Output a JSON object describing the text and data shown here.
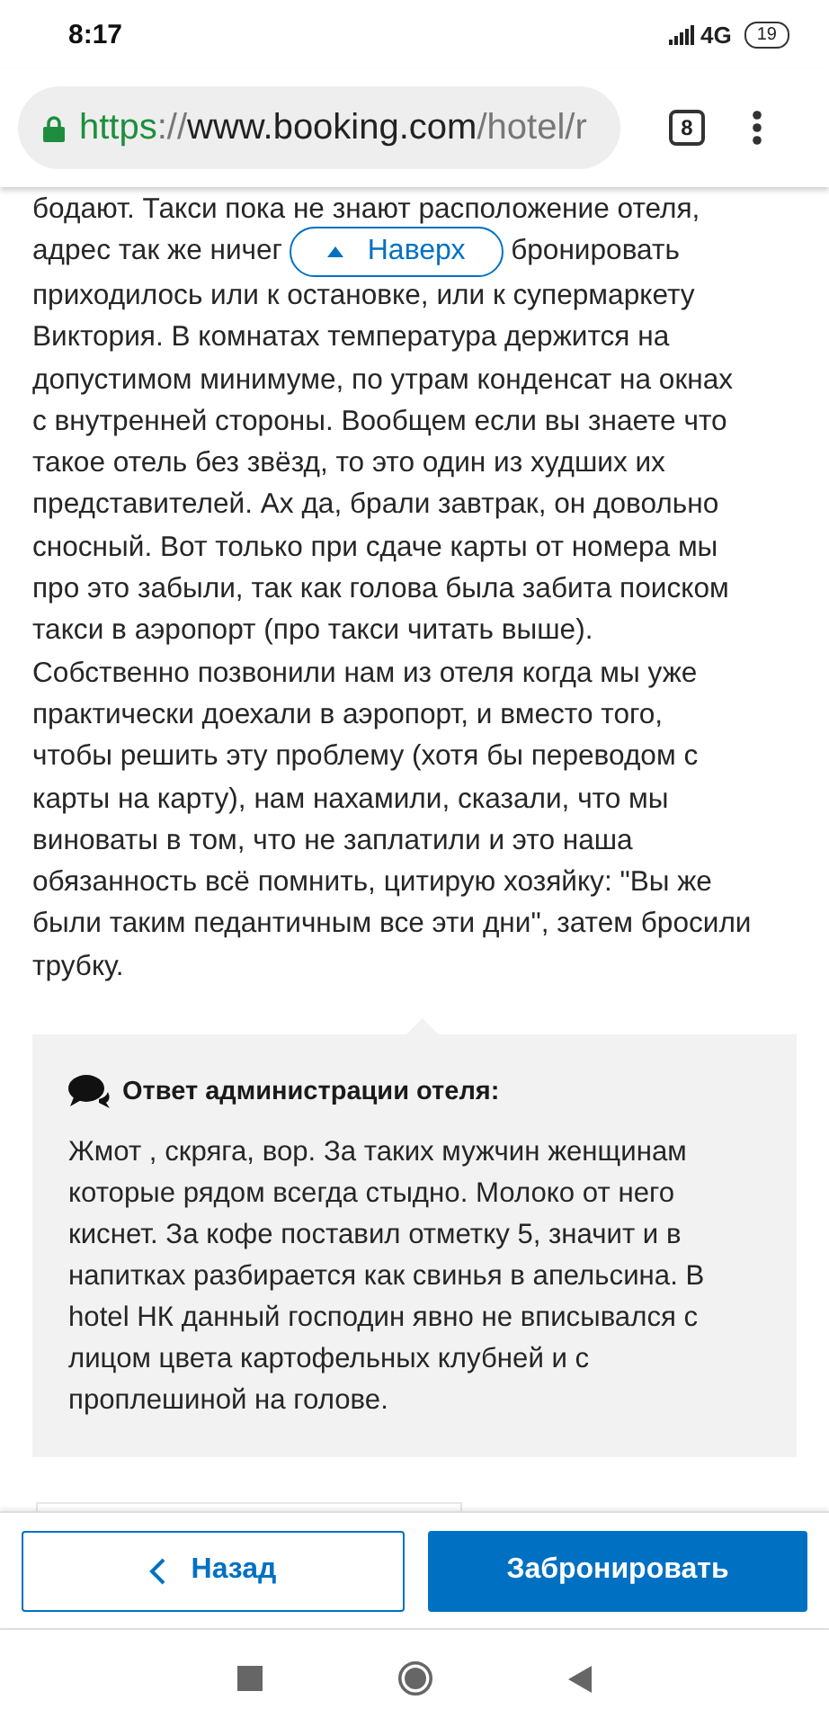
{
  "status_bar": {
    "time": "8:17",
    "network": "4G",
    "battery": "19"
  },
  "address_bar": {
    "scheme": "https",
    "separator": "://",
    "host": "www.booking.com",
    "path": "/hotel/r",
    "tab_count": "8"
  },
  "scroll_top_button": {
    "label": "Наверх"
  },
  "review": {
    "lines": [
      [
        "бодают. Такси пока не знают расположение отеля,"
      ],
      [
        "адрес так же ничег",
        "бронировать"
      ],
      [
        "приходилось или к остановке, или к супермаркету"
      ],
      [
        "Виктория. В комнатах температура держится на"
      ],
      [
        "допустимом минимуме, по утрам конденсат на окнах"
      ],
      [
        "с внутренней стороны. Вообщем если вы знаете что"
      ],
      [
        "такое отель без звёзд, то это один из худших их"
      ],
      [
        "представителей. Ах да, брали завтрак, он довольно"
      ],
      [
        "сносный. Вот только при сдаче карты от номера мы"
      ],
      [
        "про это забыли, так как голова была забита поиском"
      ],
      [
        "такси в аэропорт (про такси читать выше)."
      ],
      [
        "Собственно позвонили нам из отеля когда мы уже"
      ],
      [
        "практически доехали в аэропорт, и вместо того,"
      ],
      [
        "чтобы решить эту проблему (хотя бы переводом с"
      ],
      [
        "карты на карту), нам нахамили, сказали, что мы"
      ],
      [
        "виноваты в том, что не заплатили и это наша"
      ],
      [
        "обязанность всё помнить, цитирую хозяйку: \"Вы же"
      ],
      [
        "были таким педантичным все эти дни\", затем бросили"
      ],
      [
        "трубку."
      ]
    ]
  },
  "hotel_response": {
    "title": "Ответ администрации отеля:",
    "lines": [
      "Жмот , скряга, вор. За таких мужчин женщинам",
      "которые рядом всегда стыдно. Молоко от него",
      "киснет. За кофе поставил отметку 5, значит и в",
      "напитках разбирается как свинья в апельсина. В",
      "hotel НК данный господин явно не вписывался с",
      "лицом цвета картофельных клубней и с",
      "проплешиной на голове."
    ]
  },
  "bottom_bar": {
    "back_button": "Назад",
    "book_button": "Забронировать"
  }
}
